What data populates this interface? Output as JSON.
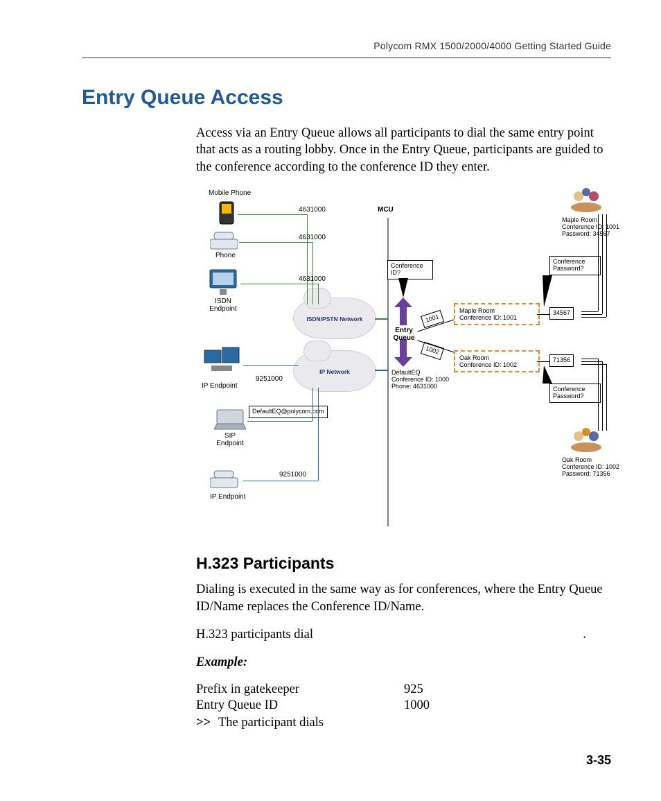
{
  "running_head": "Polycom RMX 1500/2000/4000 Getting Started Guide",
  "section_title": "Entry Queue Access",
  "intro_paragraph": "Access via an Entry Queue allows all participants to dial the same entry point that acts as a routing lobby. Once in the Entry Queue, participants are guided to the conference according to the conference ID they enter.",
  "diagram": {
    "mcu_label": "MCU",
    "left_endpoints": [
      {
        "label": "Mobile Phone",
        "dial": "4631000"
      },
      {
        "label": "Phone",
        "dial": "4631000"
      },
      {
        "label": "ISDN Endpoint",
        "dial": "4631000"
      },
      {
        "label": "IP Endpoint",
        "dial": "9251000"
      },
      {
        "label": "SIP Endpoint",
        "dial": "DefaultEQ@polycom.com"
      },
      {
        "label": "IP Endpoint",
        "dial": "9251000"
      }
    ],
    "networks": {
      "isdn": "ISDN/PSTN Network",
      "ip": "IP Network"
    },
    "entry_queue": {
      "label": "Entry Queue",
      "default_text": "DefaultEQ\nConference ID: 1000\nPhone: 4631000"
    },
    "callouts": {
      "conf_id_prompt": "Conference ID?",
      "conf_pw_prompt": "Conference Password?",
      "id_1": "1001",
      "id_2": "1002"
    },
    "rooms": [
      {
        "name": "Maple Room",
        "conf_id": "1001",
        "password": "34567"
      },
      {
        "name": "Oak Room",
        "conf_id": "1002",
        "password": "71356"
      }
    ]
  },
  "sub": {
    "heading": "H.323 Participants",
    "para": "Dialing is executed in the same way as for conferences, where the Entry Queue ID/Name replaces the Conference ID/Name.",
    "dial_line_left": "H.323 participants dial",
    "dial_line_right": ".",
    "example_label": "Example:",
    "rows": [
      {
        "k": "Prefix in gatekeeper",
        "v": "925"
      },
      {
        "k": "Entry Queue ID",
        "v": "1000"
      }
    ],
    "result": {
      "chev": ">>",
      "text": "The participant dials"
    }
  },
  "page_number": "3-35"
}
